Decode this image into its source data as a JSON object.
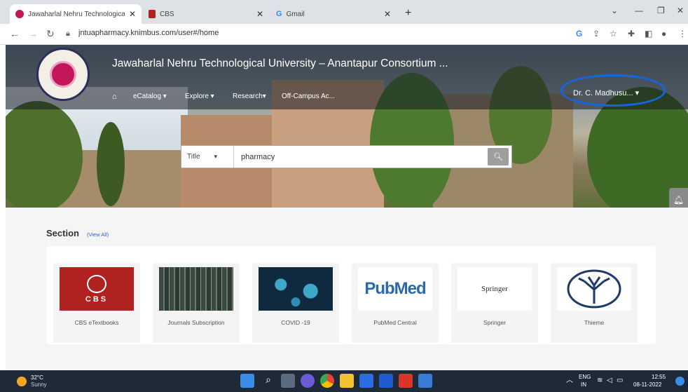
{
  "browser": {
    "tabs": [
      {
        "title": "Jawaharlal Nehru Technological U",
        "close": "✕",
        "active": true
      },
      {
        "title": "CBS",
        "close": "✕",
        "active": false
      },
      {
        "title": "Gmail",
        "close": "✕",
        "active": false
      }
    ],
    "new_tab": "+",
    "url": "jntuapharmacy.knimbus.com/user#/home"
  },
  "header": {
    "site_title": "Jawaharlal Nehru Technological University – Anantapur Consortium ...",
    "menu": {
      "home_icon": "home-icon",
      "ecatalog": "eCatalog ▾",
      "explore": "Explore ▾",
      "research": "Research▾",
      "offcampus": "Off-Campus Ac..."
    },
    "user": "Dr. C. Madhusu... ▾"
  },
  "search": {
    "field": "Title",
    "query": "pharmacy",
    "button_icon": "search-icon"
  },
  "section": {
    "title": "Section",
    "view_all": "(View All)",
    "cards": [
      {
        "label": "CBS eTextbooks",
        "thumb_text": "CBS"
      },
      {
        "label": "Journals Subscription"
      },
      {
        "label": "COVID -19"
      },
      {
        "label": "PubMed Central",
        "thumb_text": "PubMed"
      },
      {
        "label": "Springer",
        "thumb_text": "Springer"
      },
      {
        "label": "Thieme"
      }
    ]
  },
  "taskbar": {
    "weather_temp": "32°C",
    "weather_desc": "Sunny",
    "lang_top": "ENG",
    "lang_bottom": "IN",
    "time": "12:55",
    "date": "08-11-2022"
  },
  "colors": {
    "accent": "#1565e0",
    "taskbar": "#1f2a38",
    "cbs_red": "#b0221f"
  }
}
